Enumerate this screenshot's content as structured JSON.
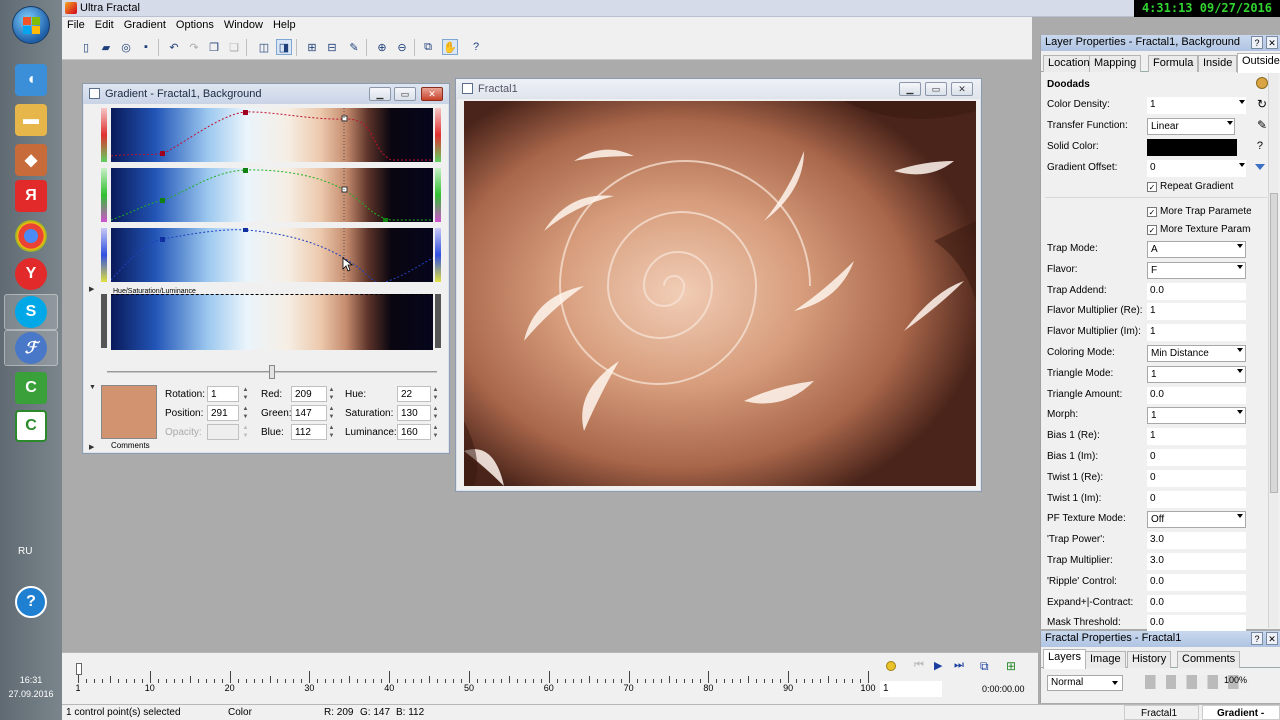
{
  "app": {
    "title": "Ultra Fractal"
  },
  "clock": "4:31:13  09/27/2016",
  "menu": [
    "File",
    "Edit",
    "Gradient",
    "Options",
    "Window",
    "Help"
  ],
  "gradient_window": {
    "title": "Gradient - Fractal1, Background",
    "hsl_label": "Hue/Saturation/Luminance",
    "rotation_label": "Rotation:",
    "rotation": "1",
    "position_label": "Position:",
    "position": "291",
    "opacity_label": "Opacity:",
    "red_label": "Red:",
    "red": "209",
    "green_label": "Green:",
    "green": "147",
    "blue_label": "Blue:",
    "blue": "112",
    "hue_label": "Hue:",
    "hue": "22",
    "saturation_label": "Saturation:",
    "saturation": "130",
    "luminance_label": "Luminance:",
    "luminance": "160",
    "comments_label": "Comments",
    "swatch_color": "#d19370"
  },
  "fractal_window": {
    "title": "Fractal1"
  },
  "layer_properties": {
    "title": "Layer Properties - Fractal1, Background",
    "tabs": [
      "Location",
      "Mapping",
      "Formula",
      "Inside",
      "Outside"
    ],
    "active_tab": "Outside",
    "section": "Doodads",
    "rows": [
      {
        "label": "Color Density:",
        "value": "1"
      },
      {
        "label": "Transfer Function:",
        "value": "Linear"
      },
      {
        "label": "Solid Color:",
        "value": ""
      },
      {
        "label": "Gradient Offset:",
        "value": "0"
      }
    ],
    "checks": [
      "Repeat Gradient",
      "More Trap Parameters",
      "More Texture Parameters"
    ],
    "rows2": [
      {
        "label": "Trap Mode:",
        "value": "A"
      },
      {
        "label": "Flavor:",
        "value": "F"
      },
      {
        "label": "Trap Addend:",
        "value": "0.0"
      },
      {
        "label": "Flavor Multiplier (Re):",
        "value": "1"
      },
      {
        "label": "Flavor Multiplier (Im):",
        "value": "1"
      },
      {
        "label": "Coloring Mode:",
        "value": "Min Distance"
      },
      {
        "label": "Triangle Mode:",
        "value": "1"
      },
      {
        "label": "Triangle Amount:",
        "value": "0.0"
      },
      {
        "label": "Morph:",
        "value": "1"
      },
      {
        "label": "Bias 1 (Re):",
        "value": "1"
      },
      {
        "label": "Bias 1 (Im):",
        "value": "0"
      },
      {
        "label": "Twist 1 (Re):",
        "value": "0"
      },
      {
        "label": "Twist 1 (Im):",
        "value": "0"
      },
      {
        "label": "PF Texture Mode:",
        "value": "Off"
      },
      {
        "label": "'Trap Power':",
        "value": "3.0"
      },
      {
        "label": "Trap Multiplier:",
        "value": "3.0"
      },
      {
        "label": "'Ripple' Control:",
        "value": "0.0"
      },
      {
        "label": "Expand+|-Contract:",
        "value": "0.0"
      },
      {
        "label": "Mask Threshold:",
        "value": "0.0"
      }
    ]
  },
  "fractal_properties": {
    "title": "Fractal Properties - Fractal1",
    "tabs": [
      "Layers",
      "Image",
      "History",
      "Comments"
    ],
    "blend_mode": "Normal",
    "opacity": "100%"
  },
  "timeline": {
    "labels": [
      "1",
      "10",
      "20",
      "30",
      "40",
      "50",
      "60",
      "70",
      "80",
      "90",
      "100"
    ],
    "frame": "1",
    "time": "0:00:00.00"
  },
  "status": {
    "selection": "1 control point(s) selected",
    "mode": "Color",
    "r": "R: 209",
    "g": "G: 147",
    "b": "B: 112",
    "task1": "Fractal1",
    "task2": "Gradient - Fr..."
  },
  "tray": {
    "lang": "RU",
    "time": "16:31",
    "date": "27.09.2016"
  }
}
